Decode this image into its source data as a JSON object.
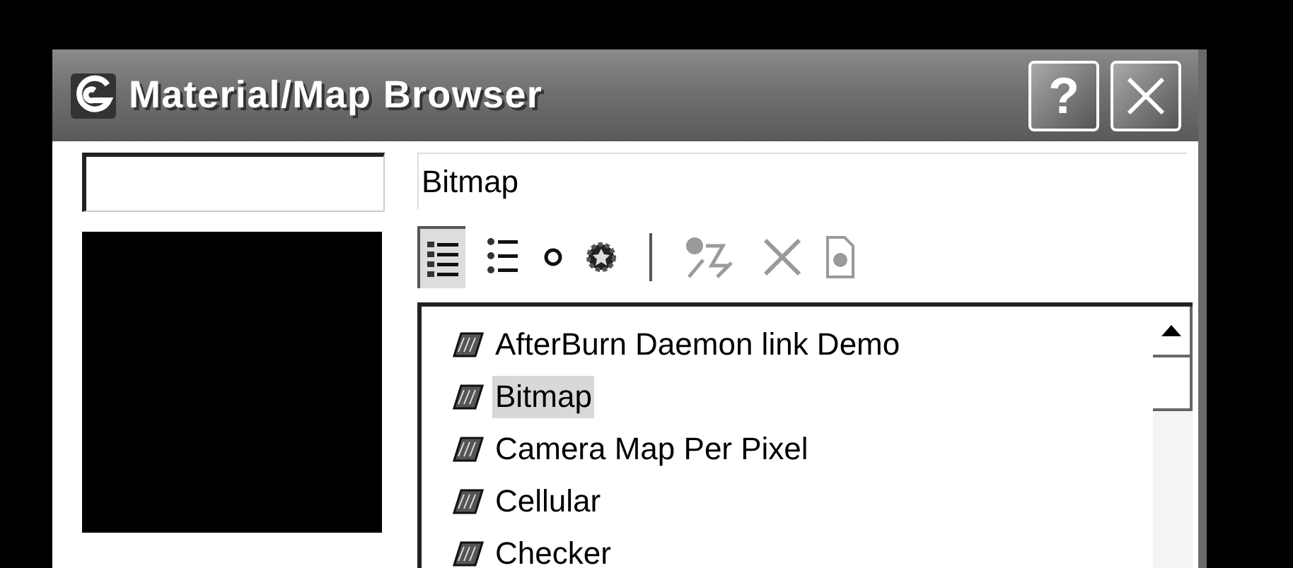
{
  "window": {
    "title": "Material/Map Browser",
    "help_button": "?"
  },
  "name_field": {
    "value": "Bitmap"
  },
  "view_modes": [
    {
      "kind": "list-icons",
      "selected": true
    },
    {
      "kind": "list-small",
      "selected": false
    },
    {
      "kind": "small-icons",
      "selected": false
    },
    {
      "kind": "large-icons",
      "selected": false
    }
  ],
  "actions": [
    {
      "kind": "update",
      "disabled": true
    },
    {
      "kind": "delete",
      "disabled": true
    },
    {
      "kind": "clear",
      "disabled": true
    }
  ],
  "list": {
    "items": [
      {
        "label": "AfterBurn Daemon link Demo",
        "selected": false
      },
      {
        "label": "Bitmap",
        "selected": true
      },
      {
        "label": "Camera Map Per Pixel",
        "selected": false
      },
      {
        "label": "Cellular",
        "selected": false
      },
      {
        "label": "Checker",
        "selected": false
      }
    ]
  }
}
